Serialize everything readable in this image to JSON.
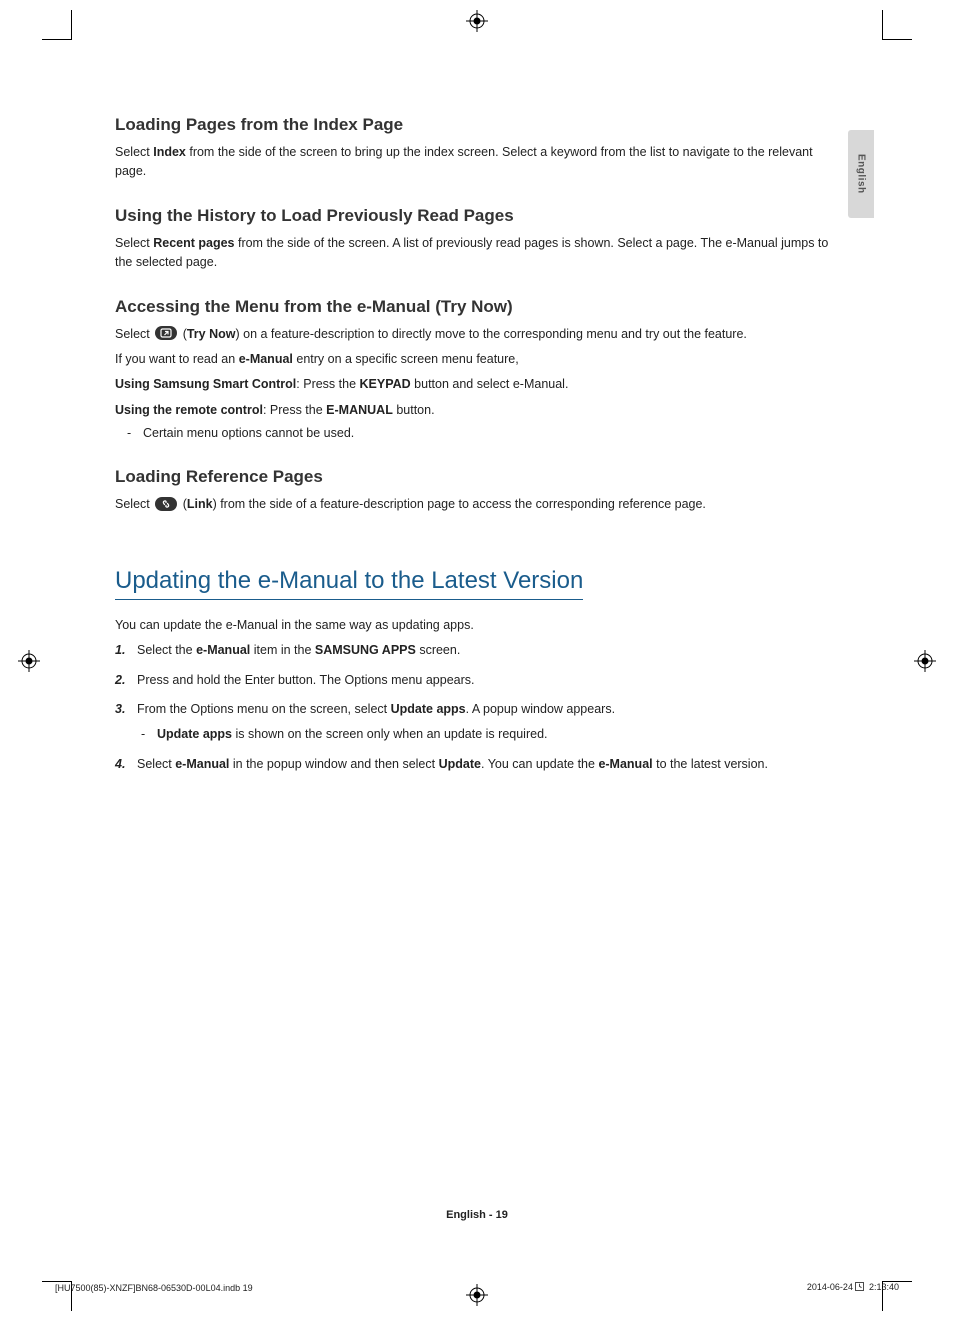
{
  "language_tab": "English",
  "sections": {
    "index_page": {
      "heading": "Loading Pages from the Index Page",
      "body_pre": "Select ",
      "body_b1": "Index",
      "body_post": " from the side of the screen to bring up the index screen. Select a keyword from the list to navigate to the relevant page."
    },
    "history": {
      "heading": "Using the History to Load Previously Read Pages",
      "body_pre": "Select ",
      "body_b1": "Recent pages",
      "body_post": " from the side of the screen. A list of previously read pages is shown. Select a page. The e-Manual jumps to the selected page."
    },
    "try_now": {
      "heading": "Accessing the Menu from the e-Manual (Try Now)",
      "p1_pre": "Select ",
      "p1_paren_open": " (",
      "p1_b": "Try Now",
      "p1_post": ") on a feature-description to directly move to the corresponding menu and try out the feature.",
      "p2_pre": "If you want to read an ",
      "p2_b": "e-Manual",
      "p2_post": " entry on a specific screen menu feature,",
      "p3_b": "Using Samsung Smart Control",
      "p3_mid": ": Press the ",
      "p3_b2": "KEYPAD",
      "p3_post": " button and select e-Manual.",
      "p4_b": "Using the remote control",
      "p4_mid": ": Press the ",
      "p4_b2": "E-MANUAL",
      "p4_post": " button.",
      "note": "Certain menu options cannot be used."
    },
    "reference": {
      "heading": "Loading Reference Pages",
      "p_pre": "Select ",
      "p_paren_open": " (",
      "p_b": "Link",
      "p_post": ") from the side of a feature-description page to access the corresponding reference page."
    },
    "updating": {
      "heading": "Updating the e-Manual to the Latest Version",
      "intro": "You can update the e-Manual in the same way as updating apps.",
      "steps": {
        "s1_pre": "Select the ",
        "s1_b1": "e-Manual",
        "s1_mid": " item in the ",
        "s1_b2": "SAMSUNG APPS",
        "s1_post": " screen.",
        "s2": "Press and hold the Enter button. The Options menu appears.",
        "s3_pre": "From the Options menu on the screen, select ",
        "s3_b": "Update apps",
        "s3_post": ". A popup window appears.",
        "s3_note_b": "Update apps",
        "s3_note_post": " is shown on the screen only when an update is required.",
        "s4_pre": "Select ",
        "s4_b1": "e-Manual",
        "s4_mid1": " in the popup window and then select ",
        "s4_b2": "Update",
        "s4_mid2": ". You can update the ",
        "s4_b3": "e-Manual",
        "s4_post": " to the latest version."
      }
    }
  },
  "footer": {
    "page_label": "English - 19",
    "imprint_left": "[HU7500(85)-XNZF]BN68-06530D-00L04.indb   19",
    "imprint_date": "2014-06-24   ",
    "imprint_time": "2:13:40"
  }
}
